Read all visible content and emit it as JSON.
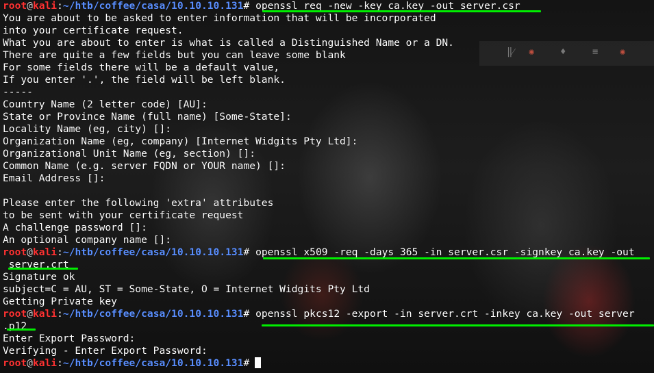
{
  "terminal": {
    "prompt": {
      "user": "root",
      "at": "@",
      "host": "kali",
      "colon": ":",
      "path": "~/htb/coffee/casa/10.10.10.131",
      "symbol": "#"
    },
    "commands": {
      "c1": "openssl req -new -key ca.key -out server.csr",
      "c2": "openssl x509 -req -days 365 -in server.csr -signkey ca.key -out",
      "c2_wrap": "server.crt",
      "c3": "openssl pkcs12 -export -in server.crt -inkey ca.key -out server",
      "c3_wrap": ".p12"
    },
    "output": [
      "You are about to be asked to enter information that will be incorporated",
      "into your certificate request.",
      "What you are about to enter is what is called a Distinguished Name or a DN.",
      "There are quite a few fields but you can leave some blank",
      "For some fields there will be a default value,",
      "If you enter '.', the field will be left blank.",
      "-----",
      "Country Name (2 letter code) [AU]:",
      "State or Province Name (full name) [Some-State]:",
      "Locality Name (eg, city) []:",
      "Organization Name (eg, company) [Internet Widgits Pty Ltd]:",
      "Organizational Unit Name (eg, section) []:",
      "Common Name (e.g. server FQDN or YOUR name) []:",
      "Email Address []:",
      "",
      "Please enter the following 'extra' attributes",
      "to be sent with your certificate request",
      "A challenge password []:",
      "An optional company name []:",
      "Signature ok",
      "subject=C = AU, ST = Some-State, O = Internet Widgits Pty Ltd",
      "Getting Private key",
      "Enter Export Password:",
      "Verifying - Enter Export Password:"
    ]
  },
  "colors": {
    "highlight": "#00ee00",
    "prompt_user": "#ff3333",
    "prompt_path": "#5a8fff",
    "text": "#ffffff"
  }
}
